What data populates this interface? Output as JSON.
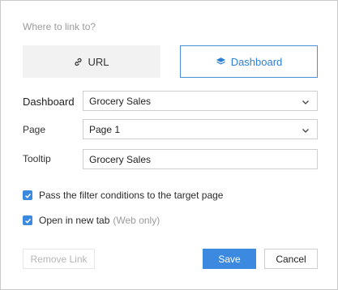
{
  "dialog": {
    "hint": "Where to link to?",
    "link_types": {
      "url": {
        "label": "URL",
        "icon": "link-icon"
      },
      "dashboard": {
        "label": "Dashboard",
        "icon": "dashboard-stack-icon",
        "selected": true
      }
    },
    "fields": {
      "dashboard": {
        "label": "Dashboard",
        "value": "Grocery Sales"
      },
      "page": {
        "label": "Page",
        "value": "Page 1"
      },
      "tooltip": {
        "label": "Tooltip",
        "value": "Grocery Sales"
      }
    },
    "options": {
      "pass_filters": {
        "label": "Pass the filter conditions to the target page",
        "checked": true
      },
      "new_tab": {
        "label": "Open in new tab",
        "note": "(Web only)",
        "checked": true
      }
    },
    "buttons": {
      "remove": "Remove Link",
      "save": "Save",
      "cancel": "Cancel"
    }
  },
  "colors": {
    "accent": "#3b8ae0",
    "selected_border": "#4a90d9",
    "muted_text": "#9b9b9b"
  }
}
